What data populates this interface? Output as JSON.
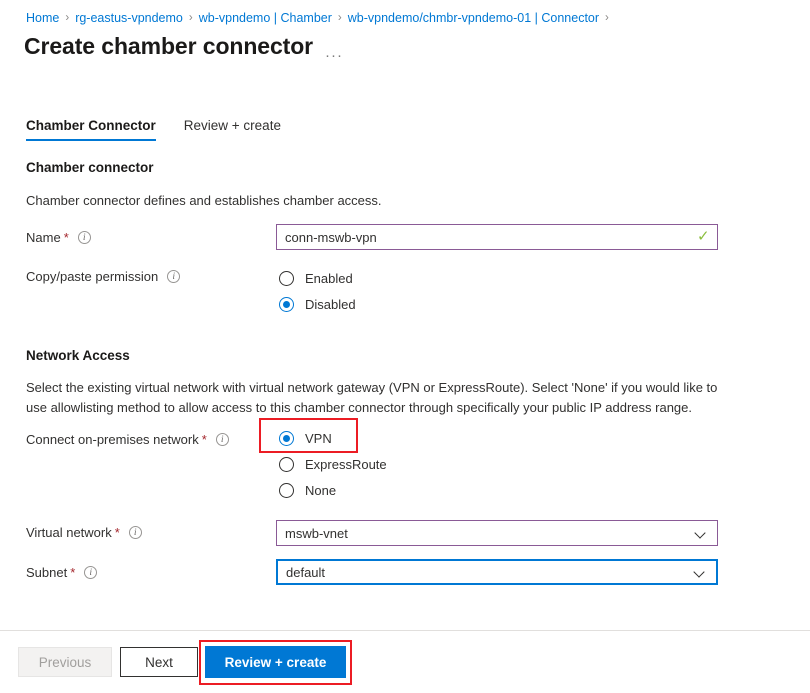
{
  "breadcrumb": {
    "separator": "›",
    "items": [
      {
        "label": "Home"
      },
      {
        "label": "rg-eastus-vpndemo"
      },
      {
        "label": "wb-vpndemo | Chamber"
      },
      {
        "label": "wb-vpndemo/chmbr-vpndemo-01 | Connector"
      }
    ]
  },
  "header": {
    "title": "Create chamber connector",
    "ellipsis": "···"
  },
  "tabs": [
    {
      "label": "Chamber Connector",
      "active": true
    },
    {
      "label": "Review + create",
      "active": false
    }
  ],
  "sections": {
    "chamber": {
      "heading": "Chamber connector",
      "description": "Chamber connector defines and establishes chamber access."
    },
    "network": {
      "heading": "Network Access",
      "description": "Select the existing virtual network with virtual network gateway (VPN or ExpressRoute). Select 'None' if you would like to use allowlisting method to allow access to this chamber connector through specifically your public IP address range."
    }
  },
  "fields": {
    "name": {
      "label": "Name",
      "required": "*",
      "value": "conn-mswb-vpn",
      "placeholder": "",
      "validation_icon": "✓",
      "info_icon": "i"
    },
    "copy_paste": {
      "label": "Copy/paste permission",
      "info_icon": "i",
      "options": [
        {
          "label": "Enabled",
          "checked": false
        },
        {
          "label": "Disabled",
          "checked": true
        }
      ]
    },
    "connect_on_premises": {
      "label": "Connect on-premises network",
      "required": "*",
      "info_icon": "i",
      "options": [
        {
          "label": "VPN",
          "checked": true
        },
        {
          "label": "ExpressRoute",
          "checked": false
        },
        {
          "label": "None",
          "checked": false
        }
      ]
    },
    "virtual_network": {
      "label": "Virtual network",
      "required": "*",
      "info_icon": "i",
      "value": "mswb-vnet"
    },
    "subnet": {
      "label": "Subnet",
      "required": "*",
      "info_icon": "i",
      "value": "default"
    }
  },
  "footer": {
    "previous_label": "Previous",
    "next_label": "Next",
    "review_label": "Review + create"
  },
  "colors": {
    "accent": "#0078d4",
    "link": "#0078d4",
    "required_asterisk": "#a4262c",
    "field_border_valid": "#8a5a96",
    "field_border_focus": "#0078d4",
    "validation_check": "#8cbe3f",
    "highlight_box": "#ec1c24"
  }
}
